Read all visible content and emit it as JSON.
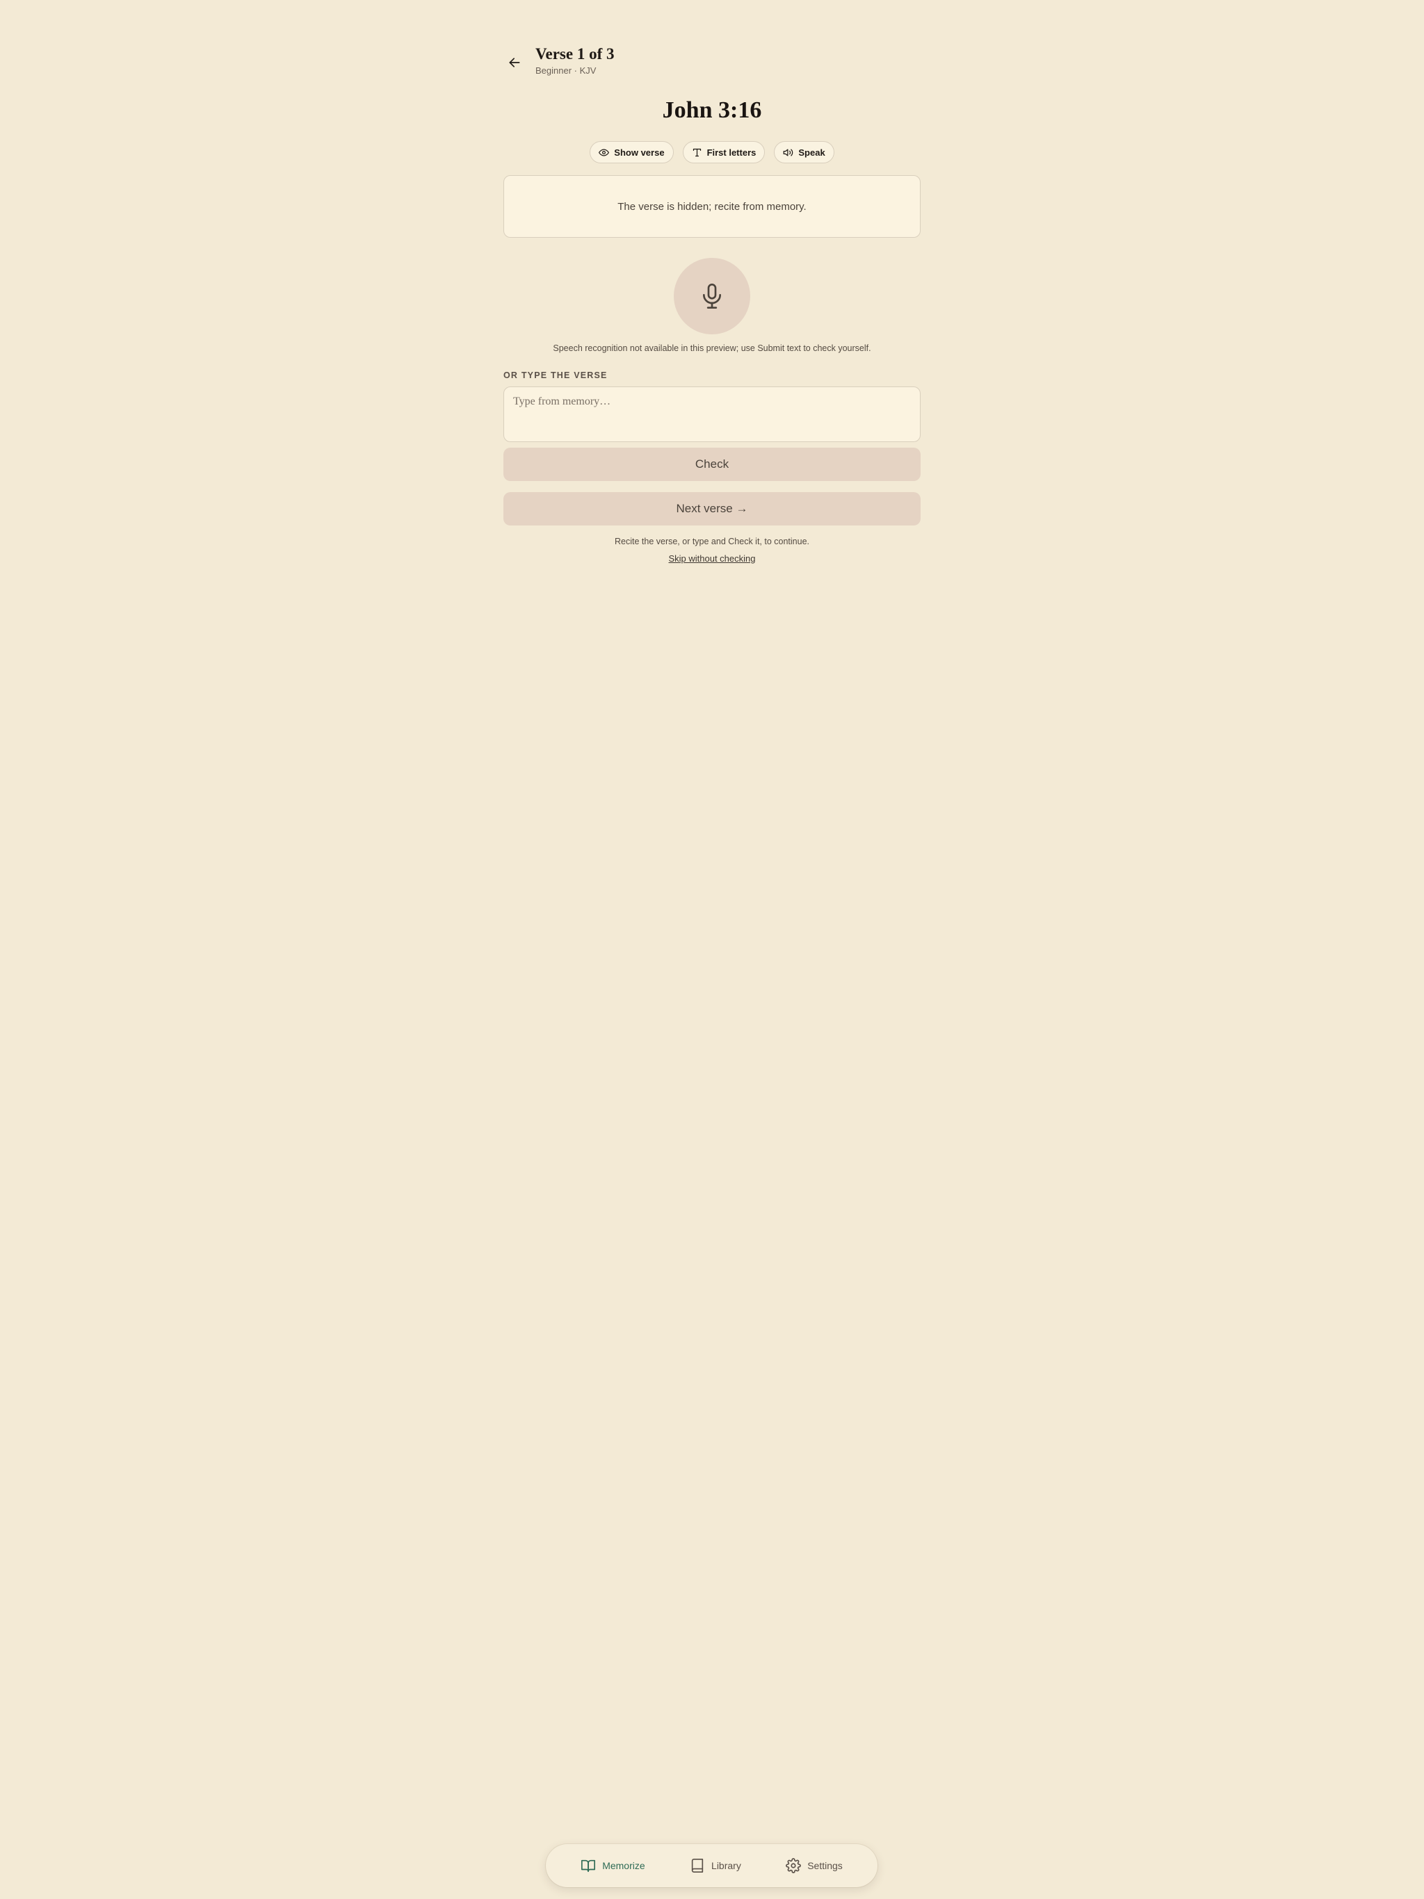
{
  "header": {
    "title": "Verse 1 of 3",
    "subtitle": "Beginner · KJV"
  },
  "verse": {
    "reference": "John 3:16",
    "hidden_message": "The verse is hidden; recite from memory."
  },
  "chips": {
    "show_verse": "Show verse",
    "first_letters": "First letters",
    "speak": "Speak"
  },
  "speech": {
    "note": "Speech recognition not available in this preview; use Submit text to check yourself."
  },
  "typing": {
    "label": "OR TYPE THE VERSE",
    "placeholder": "Type from memory…",
    "value": ""
  },
  "actions": {
    "check": "Check",
    "next": "Next verse →",
    "hint": "Recite the verse, or type and Check it, to continue.",
    "skip": "Skip without checking"
  },
  "nav": {
    "memorize": "Memorize",
    "library": "Library",
    "settings": "Settings"
  },
  "icons": {
    "back": "arrow-left-icon",
    "show_verse": "eye-icon",
    "first_letters": "type-icon",
    "speak": "speaker-icon",
    "mic": "microphone-icon",
    "memorize": "open-book-icon",
    "library": "book-icon",
    "settings": "gear-icon"
  },
  "colors": {
    "background": "#f3ead5",
    "card": "#fbf3e0",
    "button": "#e5d3c3",
    "accent": "#2e6b55"
  }
}
